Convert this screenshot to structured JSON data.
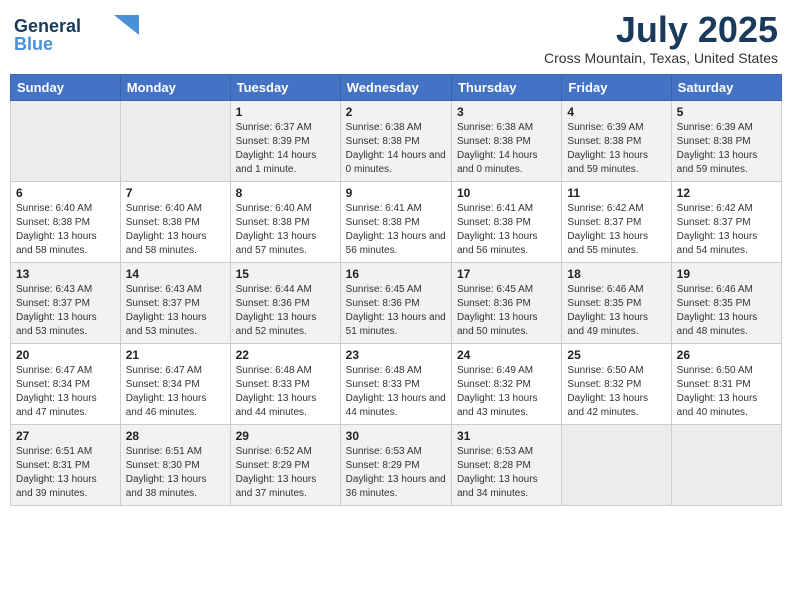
{
  "header": {
    "logo_line1": "General",
    "logo_line2": "Blue",
    "month": "July 2025",
    "location": "Cross Mountain, Texas, United States"
  },
  "weekdays": [
    "Sunday",
    "Monday",
    "Tuesday",
    "Wednesday",
    "Thursday",
    "Friday",
    "Saturday"
  ],
  "weeks": [
    [
      {
        "day": "",
        "info": ""
      },
      {
        "day": "",
        "info": ""
      },
      {
        "day": "1",
        "info": "Sunrise: 6:37 AM\nSunset: 8:39 PM\nDaylight: 14 hours and 1 minute."
      },
      {
        "day": "2",
        "info": "Sunrise: 6:38 AM\nSunset: 8:38 PM\nDaylight: 14 hours and 0 minutes."
      },
      {
        "day": "3",
        "info": "Sunrise: 6:38 AM\nSunset: 8:38 PM\nDaylight: 14 hours and 0 minutes."
      },
      {
        "day": "4",
        "info": "Sunrise: 6:39 AM\nSunset: 8:38 PM\nDaylight: 13 hours and 59 minutes."
      },
      {
        "day": "5",
        "info": "Sunrise: 6:39 AM\nSunset: 8:38 PM\nDaylight: 13 hours and 59 minutes."
      }
    ],
    [
      {
        "day": "6",
        "info": "Sunrise: 6:40 AM\nSunset: 8:38 PM\nDaylight: 13 hours and 58 minutes."
      },
      {
        "day": "7",
        "info": "Sunrise: 6:40 AM\nSunset: 8:38 PM\nDaylight: 13 hours and 58 minutes."
      },
      {
        "day": "8",
        "info": "Sunrise: 6:40 AM\nSunset: 8:38 PM\nDaylight: 13 hours and 57 minutes."
      },
      {
        "day": "9",
        "info": "Sunrise: 6:41 AM\nSunset: 8:38 PM\nDaylight: 13 hours and 56 minutes."
      },
      {
        "day": "10",
        "info": "Sunrise: 6:41 AM\nSunset: 8:38 PM\nDaylight: 13 hours and 56 minutes."
      },
      {
        "day": "11",
        "info": "Sunrise: 6:42 AM\nSunset: 8:37 PM\nDaylight: 13 hours and 55 minutes."
      },
      {
        "day": "12",
        "info": "Sunrise: 6:42 AM\nSunset: 8:37 PM\nDaylight: 13 hours and 54 minutes."
      }
    ],
    [
      {
        "day": "13",
        "info": "Sunrise: 6:43 AM\nSunset: 8:37 PM\nDaylight: 13 hours and 53 minutes."
      },
      {
        "day": "14",
        "info": "Sunrise: 6:43 AM\nSunset: 8:37 PM\nDaylight: 13 hours and 53 minutes."
      },
      {
        "day": "15",
        "info": "Sunrise: 6:44 AM\nSunset: 8:36 PM\nDaylight: 13 hours and 52 minutes."
      },
      {
        "day": "16",
        "info": "Sunrise: 6:45 AM\nSunset: 8:36 PM\nDaylight: 13 hours and 51 minutes."
      },
      {
        "day": "17",
        "info": "Sunrise: 6:45 AM\nSunset: 8:36 PM\nDaylight: 13 hours and 50 minutes."
      },
      {
        "day": "18",
        "info": "Sunrise: 6:46 AM\nSunset: 8:35 PM\nDaylight: 13 hours and 49 minutes."
      },
      {
        "day": "19",
        "info": "Sunrise: 6:46 AM\nSunset: 8:35 PM\nDaylight: 13 hours and 48 minutes."
      }
    ],
    [
      {
        "day": "20",
        "info": "Sunrise: 6:47 AM\nSunset: 8:34 PM\nDaylight: 13 hours and 47 minutes."
      },
      {
        "day": "21",
        "info": "Sunrise: 6:47 AM\nSunset: 8:34 PM\nDaylight: 13 hours and 46 minutes."
      },
      {
        "day": "22",
        "info": "Sunrise: 6:48 AM\nSunset: 8:33 PM\nDaylight: 13 hours and 44 minutes."
      },
      {
        "day": "23",
        "info": "Sunrise: 6:48 AM\nSunset: 8:33 PM\nDaylight: 13 hours and 44 minutes."
      },
      {
        "day": "24",
        "info": "Sunrise: 6:49 AM\nSunset: 8:32 PM\nDaylight: 13 hours and 43 minutes."
      },
      {
        "day": "25",
        "info": "Sunrise: 6:50 AM\nSunset: 8:32 PM\nDaylight: 13 hours and 42 minutes."
      },
      {
        "day": "26",
        "info": "Sunrise: 6:50 AM\nSunset: 8:31 PM\nDaylight: 13 hours and 40 minutes."
      }
    ],
    [
      {
        "day": "27",
        "info": "Sunrise: 6:51 AM\nSunset: 8:31 PM\nDaylight: 13 hours and 39 minutes."
      },
      {
        "day": "28",
        "info": "Sunrise: 6:51 AM\nSunset: 8:30 PM\nDaylight: 13 hours and 38 minutes."
      },
      {
        "day": "29",
        "info": "Sunrise: 6:52 AM\nSunset: 8:29 PM\nDaylight: 13 hours and 37 minutes."
      },
      {
        "day": "30",
        "info": "Sunrise: 6:53 AM\nSunset: 8:29 PM\nDaylight: 13 hours and 36 minutes."
      },
      {
        "day": "31",
        "info": "Sunrise: 6:53 AM\nSunset: 8:28 PM\nDaylight: 13 hours and 34 minutes."
      },
      {
        "day": "",
        "info": ""
      },
      {
        "day": "",
        "info": ""
      }
    ]
  ]
}
